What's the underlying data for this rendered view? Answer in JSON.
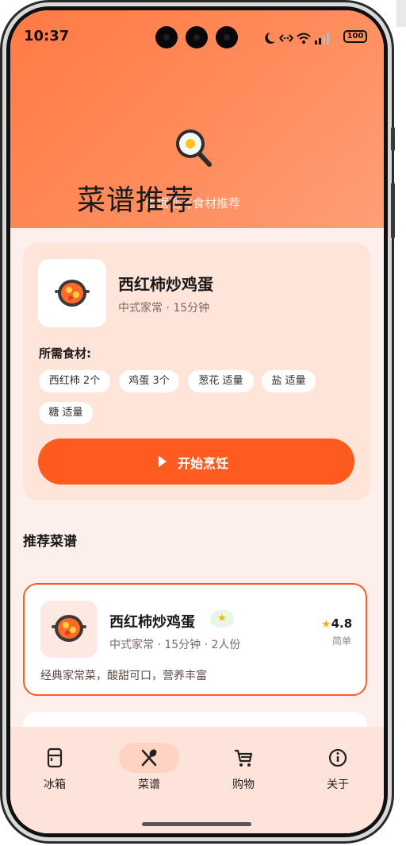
{
  "status_bar": {
    "time": "10:37",
    "battery": "100",
    "icons": [
      "moon-icon",
      "data-transfer-icon",
      "wifi-icon",
      "signal-icon",
      "battery-icon"
    ]
  },
  "header": {
    "icon": "frying-pan-egg-icon",
    "title": "菜谱推荐",
    "subtitle": "根据现有食材推荐"
  },
  "hero_recipe": {
    "name": "西红柿炒鸡蛋",
    "meta": "中式家常 · 15分钟",
    "ingredients_title": "所需食材:",
    "ingredients": [
      "西红柿 2个",
      "鸡蛋 3个",
      "葱花 适量",
      "盐 适量",
      "糖 适量"
    ],
    "cook_button": "开始烹饪"
  },
  "recommend": {
    "section_title": "推荐菜谱",
    "items": [
      {
        "name": "西红柿炒鸡蛋",
        "badge": "★",
        "meta": "中式家常 · 15分钟 · 2人份",
        "rating": "4.8",
        "difficulty": "简单",
        "description": "经典家常菜，酸甜可口，营养丰富"
      }
    ]
  },
  "tabbar": {
    "items": [
      {
        "label": "冰箱",
        "icon": "fridge-icon"
      },
      {
        "label": "菜谱",
        "icon": "utensils-icon"
      },
      {
        "label": "购物",
        "icon": "cart-icon"
      },
      {
        "label": "关于",
        "icon": "info-icon"
      }
    ],
    "active_index": 1
  },
  "colors": {
    "accent": "#ff5a1f",
    "header_gradient_start": "#ff7a45",
    "header_gradient_end": "#ff9e77",
    "page_bg": "#fdf0ec",
    "hero_bg": "#ffe4da",
    "tabbar_bg": "#fde3da",
    "tab_active_bg": "#ffd3c2"
  }
}
